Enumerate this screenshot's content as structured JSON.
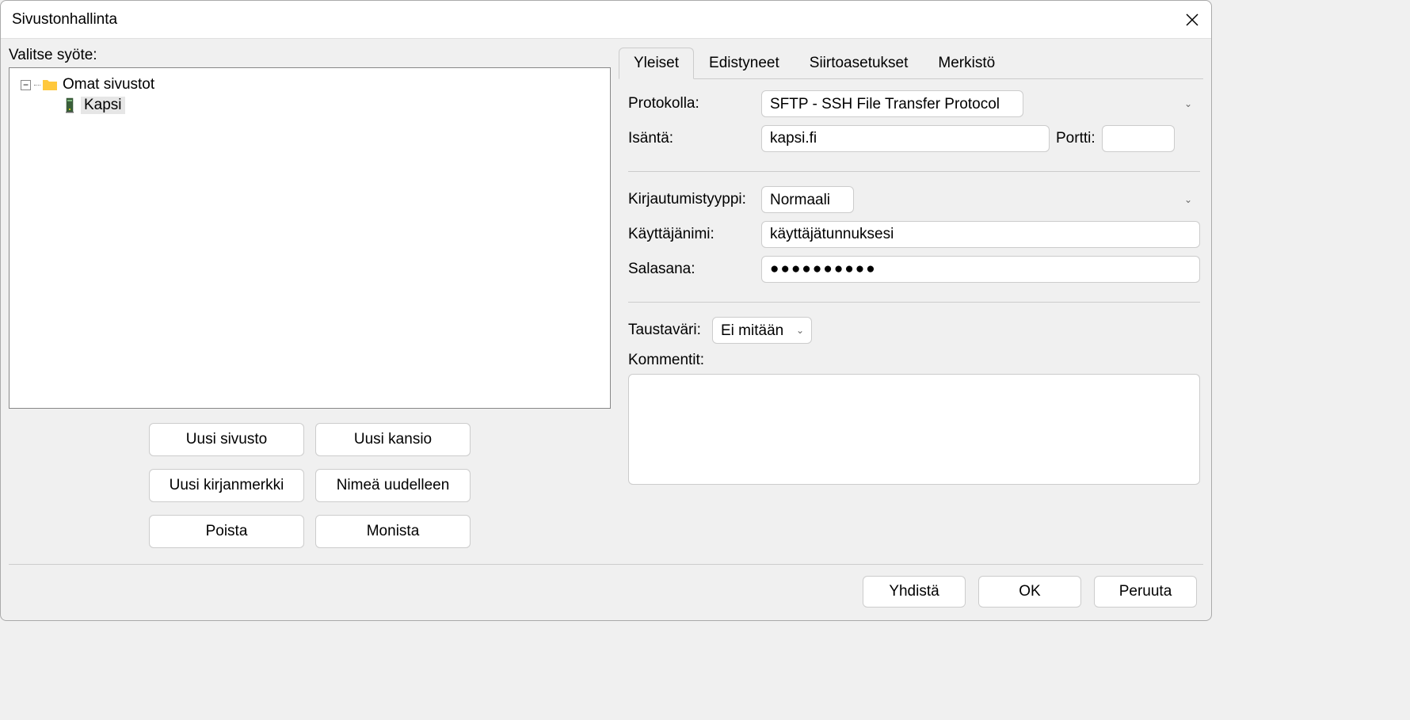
{
  "window": {
    "title": "Sivustonhallinta"
  },
  "left": {
    "selectLabel": "Valitse syöte:",
    "tree": {
      "root": "Omat sivustot",
      "item1": "Kapsi"
    },
    "buttons": {
      "newSite": "Uusi sivusto",
      "newFolder": "Uusi kansio",
      "newBookmark": "Uusi kirjanmerkki",
      "rename": "Nimeä uudelleen",
      "delete": "Poista",
      "duplicate": "Monista"
    }
  },
  "tabs": {
    "general": "Yleiset",
    "advanced": "Edistyneet",
    "transfer": "Siirtoasetukset",
    "charset": "Merkistö"
  },
  "form": {
    "protocolLabel": "Protokolla:",
    "protocolValue": "SFTP - SSH File Transfer Protocol",
    "hostLabel": "Isäntä:",
    "hostValue": "kapsi.fi",
    "portLabel": "Portti:",
    "portValue": "",
    "logonTypeLabel": "Kirjautumistyyppi:",
    "logonTypeValue": "Normaali",
    "usernameLabel": "Käyttäjänimi:",
    "usernameValue": "käyttäjätunnuksesi",
    "passwordLabel": "Salasana:",
    "passwordValue": "●●●●●●●●●●",
    "bgColorLabel": "Taustaväri:",
    "bgColorValue": "Ei mitään",
    "commentsLabel": "Kommentit:",
    "commentsValue": ""
  },
  "footer": {
    "connect": "Yhdistä",
    "ok": "OK",
    "cancel": "Peruuta"
  }
}
